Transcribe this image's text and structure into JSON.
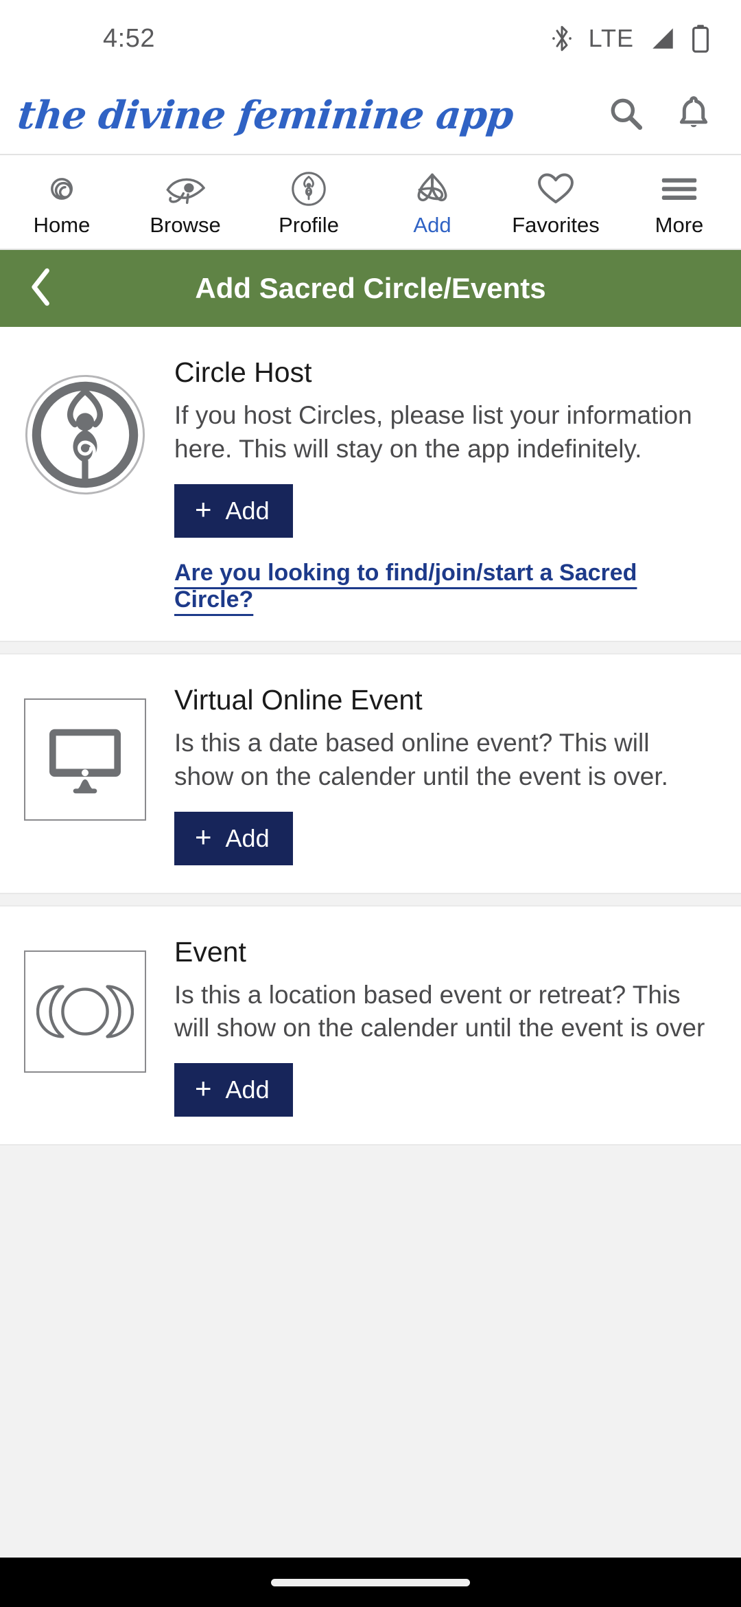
{
  "status_bar": {
    "time": "4:52",
    "network_label": "LTE",
    "icons": [
      "bluetooth-icon",
      "signal-icon",
      "battery-icon"
    ]
  },
  "header": {
    "logo_text": "the divine feminine app",
    "logo_color": "#2f62c4",
    "actions": [
      {
        "name": "search-icon",
        "label": "Search"
      },
      {
        "name": "notifications-bell-icon",
        "label": "Notifications"
      }
    ]
  },
  "tabs": [
    {
      "label": "Home",
      "icon": "spiral-icon",
      "active": false
    },
    {
      "label": "Browse",
      "icon": "eye-of-horus-icon",
      "active": false
    },
    {
      "label": "Profile",
      "icon": "goddess-circle-icon",
      "active": false
    },
    {
      "label": "Add",
      "icon": "triquetra-icon",
      "active": true
    },
    {
      "label": "Favorites",
      "icon": "heart-icon",
      "active": false
    },
    {
      "label": "More",
      "icon": "hamburger-menu-icon",
      "active": false
    }
  ],
  "page_header": {
    "title": "Add Sacred Circle/Events",
    "back_icon": "chevron-left-icon",
    "background_color": "#5f8345",
    "text_color": "#ffffff"
  },
  "cards": [
    {
      "id": "circle-host",
      "icon": "goddess-spiral-circle-icon",
      "title": "Circle Host",
      "description": "If you host Circles, please list your information here. This will stay on the app indefinitely.",
      "button_label": "Add",
      "button_icon": "plus-icon",
      "link_text": "Are you looking to find/join/start a Sacred Circle?"
    },
    {
      "id": "virtual-online-event",
      "icon": "desktop-monitor-icon",
      "title": "Virtual Online Event",
      "description": "Is this a date based online event? This will show on the calender until the event is over.",
      "button_label": "Add",
      "button_icon": "plus-icon",
      "link_text": ""
    },
    {
      "id": "event",
      "icon": "triple-moon-icon",
      "title": "Event",
      "description": "Is this a location based event or retreat? This will show on the calender until the event is over",
      "button_label": "Add",
      "button_icon": "plus-icon",
      "link_text": ""
    }
  ],
  "colors": {
    "accent_blue": "#2f62c4",
    "button_navy": "#17255a",
    "header_green": "#5f8345",
    "link_navy": "#1d3a8a",
    "icon_gray": "#6e7073"
  }
}
